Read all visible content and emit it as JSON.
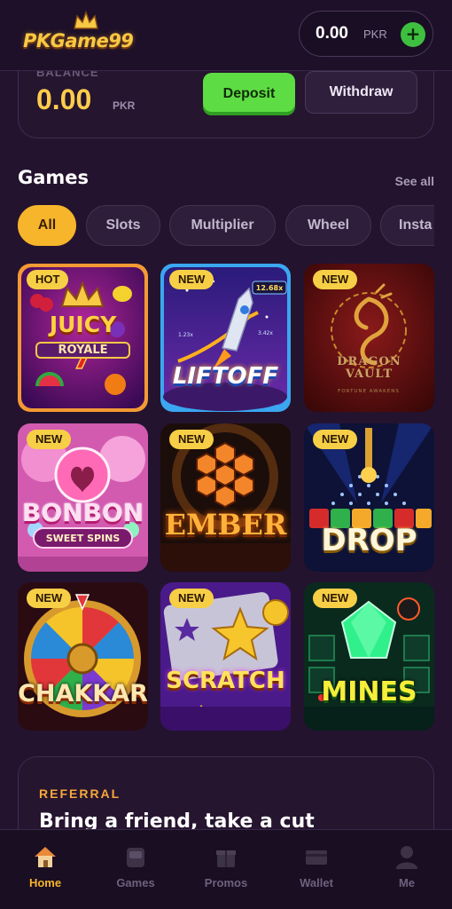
{
  "header": {
    "logo_text": "PKGame99",
    "wallet_amount": "0.00",
    "wallet_currency": "PKR",
    "add_funds_symbol": "+"
  },
  "balance": {
    "label": "BALANCE",
    "amount": "0.00",
    "currency": "PKR",
    "deposit_label": "Deposit",
    "withdraw_label": "Withdraw"
  },
  "games": {
    "title": "Games",
    "see_all": "See all",
    "filters": [
      "All",
      "Slots",
      "Multiplier",
      "Wheel",
      "Insta"
    ],
    "selected_filter": "All",
    "items": [
      {
        "title": "JUICY ROYALE",
        "line1": "JUICY",
        "line2": "ROYALE",
        "badge": "HOT"
      },
      {
        "title": "LIFTOFF",
        "badge": "NEW",
        "multiplier": "12.68x",
        "small_mult_1": "3.42x",
        "small_mult_2": "1.23x"
      },
      {
        "title": "DRAGON VAULT",
        "line1": "DRAGON",
        "line2": "VAULT",
        "subtitle": "FORTUNE AWAKENS",
        "badge": "NEW"
      },
      {
        "title": "BONBON",
        "subtitle": "SWEET SPINS",
        "badge": "NEW"
      },
      {
        "title": "EMBER",
        "badge": "NEW"
      },
      {
        "title": "DROP",
        "badge": "NEW"
      },
      {
        "title": "CHAKKAR",
        "badge": "NEW"
      },
      {
        "title": "SCRATCH",
        "badge": "NEW"
      },
      {
        "title": "MINES",
        "badge": "NEW"
      }
    ]
  },
  "referral": {
    "label": "REFERRAL",
    "title": "Bring a friend, take a cut"
  },
  "nav": {
    "items": [
      {
        "label": "Home",
        "icon": "home-icon",
        "active": true
      },
      {
        "label": "Games",
        "icon": "games-icon",
        "active": false
      },
      {
        "label": "Promos",
        "icon": "gift-icon",
        "active": false
      },
      {
        "label": "Wallet",
        "icon": "wallet-icon",
        "active": false
      },
      {
        "label": "Me",
        "icon": "user-icon",
        "active": false
      }
    ]
  },
  "colors": {
    "background": "#24132f",
    "accent": "#f6b52b",
    "deposit_green": "#5ddc43",
    "badge_yellow": "#f7cf46",
    "balance_yellow": "#ffcd4a"
  }
}
